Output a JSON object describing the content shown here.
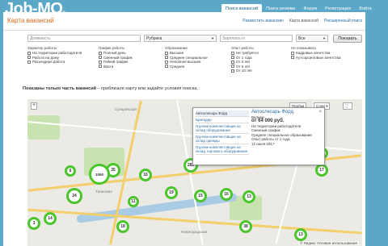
{
  "site": {
    "logo": "Job-MO",
    "logo_suffix": "ru"
  },
  "topnav": [
    "Поиск вакансий",
    "Поиск резюме",
    "Форум",
    "Регистрация",
    "Войти"
  ],
  "page": {
    "title": "Карта вакансий",
    "crumbs": [
      "Разместить вакансию",
      "Карта вакансий",
      "Расширенный поиск"
    ]
  },
  "search": {
    "position_placeholder": "Должность",
    "rubric": "Рубрика",
    "salary_placeholder": "Зарплата от",
    "currency": "Все",
    "button": "Показать"
  },
  "filters": [
    {
      "head": "Характер работы",
      "options": [
        "На территории работодателя",
        "Работа на дому",
        "Разъездная работа"
      ]
    },
    {
      "head": "График работы",
      "options": [
        "Полный день",
        "Сменный график",
        "Гибкий график",
        "Вахта"
      ]
    },
    {
      "head": "Образование",
      "options": [
        "Высшее",
        "Среднее специальное",
        "Неполное высшее",
        "Среднее"
      ]
    },
    {
      "head": "Опыт работы",
      "options": [
        "Не требуется",
        "От 1 года",
        "От 3 лет",
        "От 5 лет",
        "От 10 лет"
      ]
    },
    {
      "head": "Не показывать",
      "options": [
        "Кадровые агентства",
        "Аутсорсинговые агентства"
      ]
    }
  ],
  "info": {
    "bold": "Показаны только часть вакансий",
    "rest": " – приблизьте карту или задайте условия поиска."
  },
  "map": {
    "controls": {
      "zoom": "+",
      "traffic": "Пробки",
      "layers": "Слои"
    },
    "streets": [
      "Сухаревская",
      "Таганская",
      "Нижегородская"
    ],
    "clusters": [
      "6",
      "35",
      "282",
      "24",
      "1050",
      "16",
      "19",
      "15",
      "16",
      "17",
      "8",
      "13",
      "3",
      "14",
      "18",
      "38",
      "11",
      "13"
    ],
    "footer": "© Яндекс Условия использования"
  },
  "popup": {
    "list": [
      "Автослесарь Форд",
      "Бригадир",
      "Грузчик-комплектовщик на склад оборудования",
      "Грузчик-комплектовщик на склад одежды",
      "Грузчик-комплектовщик на склад торгового оборудования"
    ],
    "detail": {
      "title": "Автослесарь Форд",
      "company": "Велкам",
      "salary": "от 64 000 руб.",
      "lines": [
        "На территории работодателя",
        "Сменный график",
        "Среднее специальное образование",
        "Опыт работы от 1 года"
      ],
      "date": "12 июля 2017"
    },
    "close": "×"
  },
  "colors": {
    "header_bg": "#5aa7c7",
    "title": "#d76b1a",
    "cluster": "#4cc42e",
    "link": "#2b6fa5"
  }
}
